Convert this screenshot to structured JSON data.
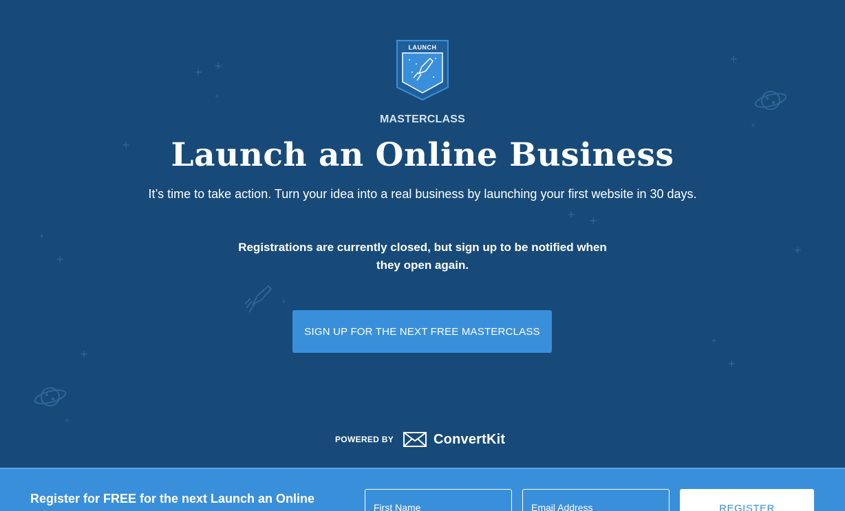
{
  "badge": {
    "label": "LAUNCH"
  },
  "hero": {
    "eyebrow": "MASTERCLASS",
    "title": "Launch an Online Business",
    "subtitle": "It’s time to take action. Turn your idea into a real business by launching your first website in 30 days.",
    "notice": "Registrations are currently closed, but sign up to be notified when they open again.",
    "cta_label": "SIGN UP FOR THE NEXT FREE MASTERCLASS"
  },
  "powered": {
    "label": "POWERED BY",
    "brand": "ConvertKit"
  },
  "footer": {
    "text": "Register for FREE for the next Launch an Online Business Masterclass",
    "first_name_placeholder": "First Name",
    "email_placeholder": "Email Address",
    "register_label": "REGISTER"
  },
  "colors": {
    "background": "#174a78",
    "accent": "#3a8fdb",
    "decoration": "#2f6699"
  },
  "icons": [
    "rocket-icon",
    "convertkit-logo-icon",
    "planet-icon",
    "star-icon"
  ]
}
